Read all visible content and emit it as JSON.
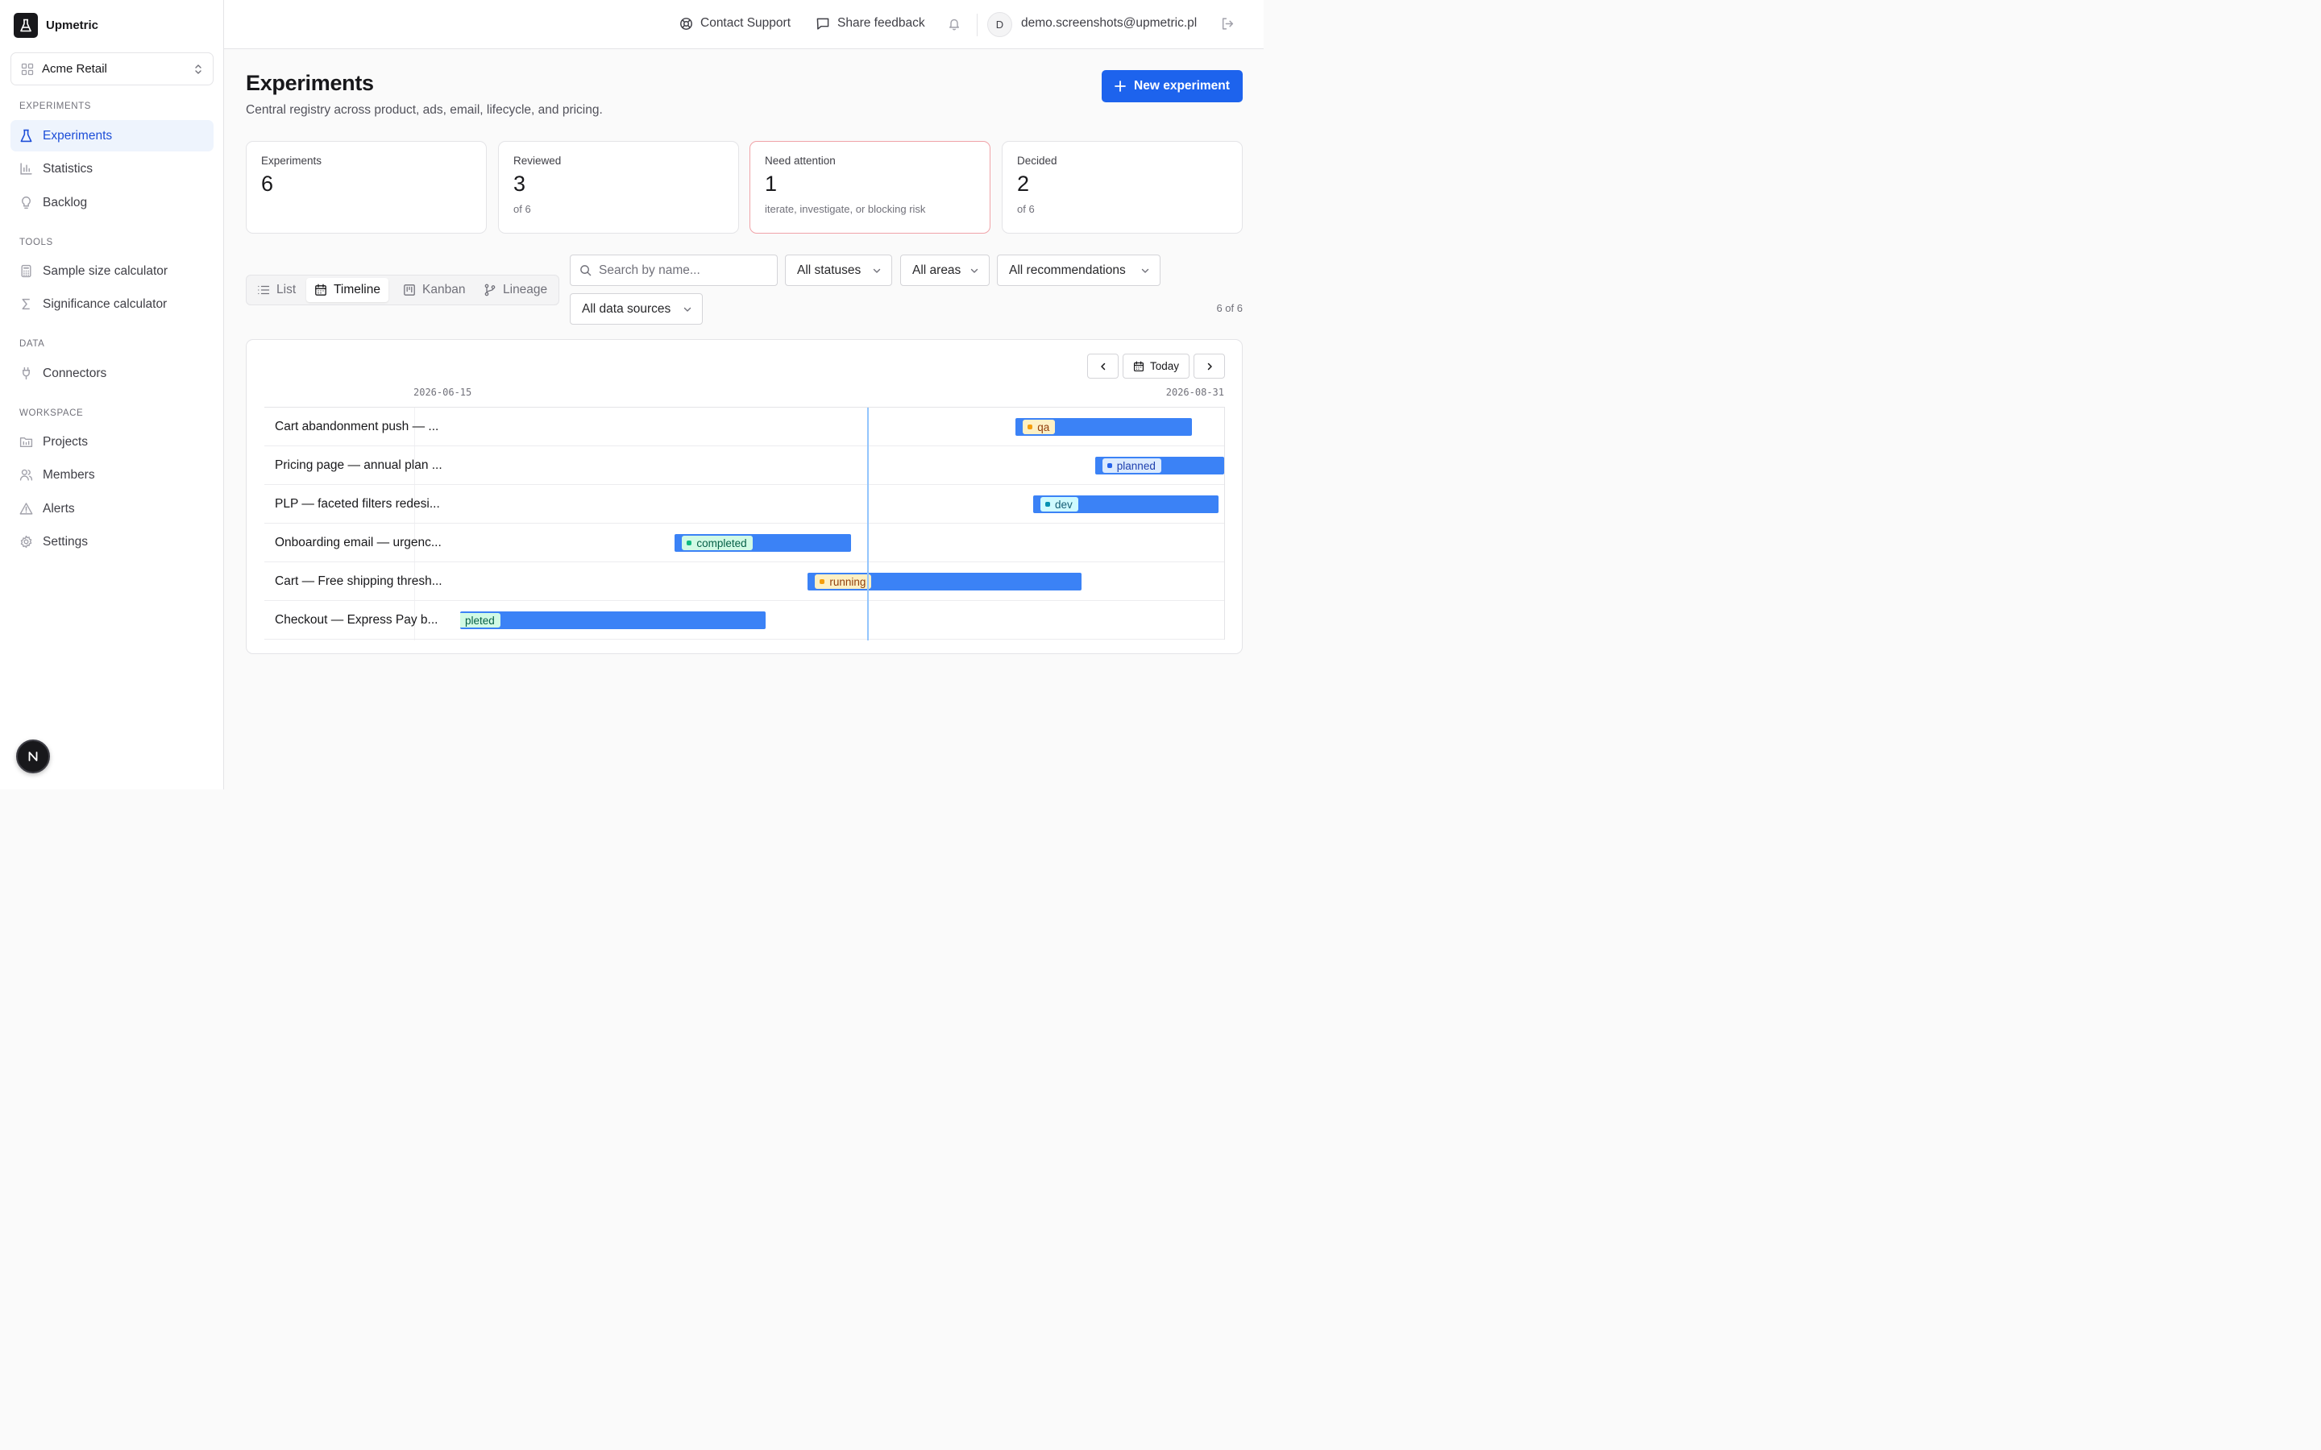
{
  "app": {
    "name": "Upmetric",
    "workspace": "Acme Retail"
  },
  "sidebar": {
    "sections": [
      {
        "title": "Experiments"
      },
      {
        "title": "Tools"
      },
      {
        "title": "Data"
      },
      {
        "title": "Workspace"
      }
    ],
    "items": [
      {
        "label": "Experiments",
        "icon": "flask-icon",
        "active": true
      },
      {
        "label": "Statistics",
        "icon": "bar-chart-icon"
      },
      {
        "label": "Backlog",
        "icon": "lightbulb-icon"
      },
      {
        "label": "Sample size calculator",
        "icon": "calculator-icon"
      },
      {
        "label": "Significance calculator",
        "icon": "sigma-icon"
      },
      {
        "label": "Connectors",
        "icon": "plug-icon"
      },
      {
        "label": "Projects",
        "icon": "folder-icon"
      },
      {
        "label": "Members",
        "icon": "users-icon"
      },
      {
        "label": "Alerts",
        "icon": "alert-triangle-icon"
      },
      {
        "label": "Settings",
        "icon": "gear-icon"
      }
    ]
  },
  "topbar": {
    "support": "Contact Support",
    "feedback": "Share feedback",
    "avatar_initial": "D",
    "email": "demo.screenshots@upmetric.pl"
  },
  "page": {
    "title": "Experiments",
    "subtitle": "Central registry across product, ads, email, lifecycle, and pricing.",
    "new_button": "New experiment"
  },
  "stats": [
    {
      "label": "Experiments",
      "value": "6",
      "sub": ""
    },
    {
      "label": "Reviewed",
      "value": "3",
      "sub": "of 6"
    },
    {
      "label": "Need attention",
      "value": "1",
      "sub": "iterate, investigate, or blocking risk"
    },
    {
      "label": "Decided",
      "value": "2",
      "sub": "of 6"
    }
  ],
  "views": [
    {
      "label": "List",
      "active": false
    },
    {
      "label": "Timeline",
      "active": true
    },
    {
      "label": "Kanban",
      "active": false
    },
    {
      "label": "Lineage",
      "active": false
    }
  ],
  "filters": {
    "search_placeholder": "Search by name...",
    "status": "All statuses",
    "area": "All areas",
    "recommendation": "All recommendations",
    "data_source": "All data sources",
    "count": "6 of 6"
  },
  "timeline": {
    "today_label": "Today",
    "start_date": "2026-06-15",
    "end_date": "2026-08-31",
    "today_fraction": 0.7,
    "rows": [
      {
        "name": "Cart abandonment push — ...",
        "status": "qa",
        "start": 0.727,
        "end": 0.958,
        "chip_bg": "#fdf0c4",
        "chip_fg": "#92400e",
        "dot": "#f59e0b"
      },
      {
        "name": "Pricing page — annual plan ...",
        "status": "planned",
        "start": 0.831,
        "end": 1.0,
        "chip_bg": "#dbeafe",
        "chip_fg": "#1e40af",
        "dot": "#2563eb"
      },
      {
        "name": "PLP — faceted filters redesi...",
        "status": "dev",
        "start": 0.75,
        "end": 0.993,
        "chip_bg": "#cffafe",
        "chip_fg": "#155e75",
        "dot": "#0891b2"
      },
      {
        "name": "Onboarding email — urgenc...",
        "status": "completed",
        "start": 0.281,
        "end": 0.512,
        "chip_bg": "#d1fae5",
        "chip_fg": "#065f46",
        "dot": "#10b981"
      },
      {
        "name": "Cart — Free shipping thresh...",
        "status": "running",
        "start": 0.455,
        "end": 0.813,
        "chip_bg": "#fdf0c4",
        "chip_fg": "#92400e",
        "dot": "#f59e0b"
      },
      {
        "name": "Checkout — Express Pay b...",
        "status": "pleted",
        "start": 0.0,
        "end": 0.4,
        "chip_bg": "#d1fae5",
        "chip_fg": "#065f46",
        "dot": ""
      }
    ]
  },
  "colors": {
    "accent": "#1d63ed",
    "bar": "#3b82f6",
    "today_line": "#93c5fd",
    "attention_border": "#f0a3a8"
  }
}
